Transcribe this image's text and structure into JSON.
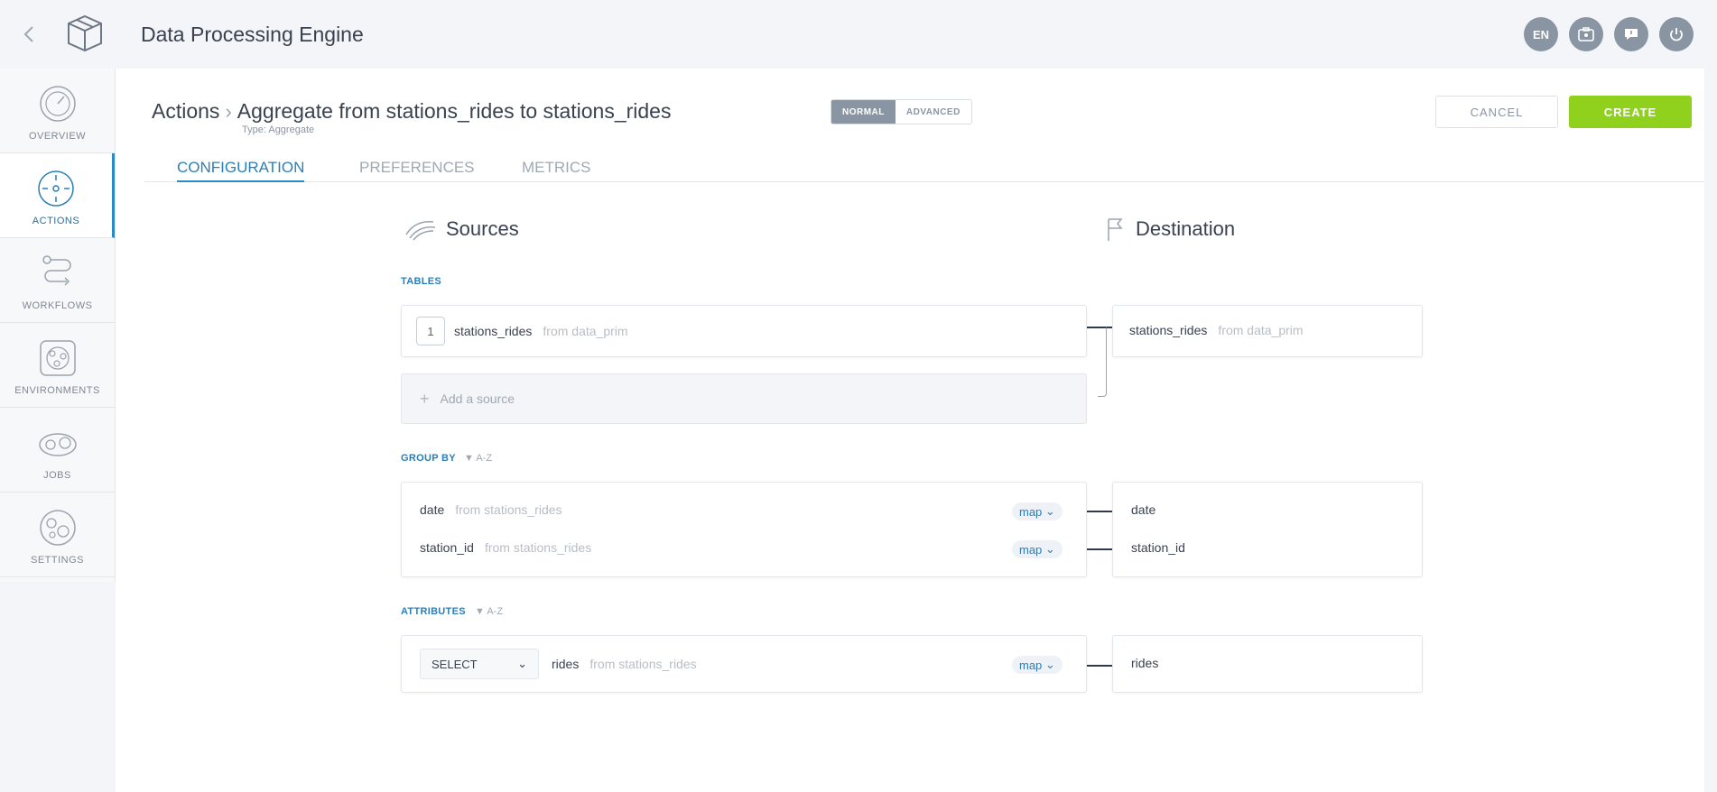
{
  "app": {
    "title": "Data Processing Engine"
  },
  "topbar": {
    "lang": "EN"
  },
  "sidebar": {
    "items": [
      {
        "label": "OVERVIEW"
      },
      {
        "label": "ACTIONS"
      },
      {
        "label": "WORKFLOWS"
      },
      {
        "label": "ENVIRONMENTS"
      },
      {
        "label": "JOBS"
      },
      {
        "label": "SETTINGS"
      }
    ]
  },
  "header": {
    "crumb_root": "Actions",
    "crumb_current": "Aggregate from stations_rides to stations_rides",
    "subtype": "Type: Aggregate",
    "mode_normal": "NORMAL",
    "mode_advanced": "ADVANCED",
    "cancel": "CANCEL",
    "create": "CREATE"
  },
  "tabs": [
    "CONFIGURATION",
    "PREFERENCES",
    "METRICS"
  ],
  "sources": {
    "title": "Sources",
    "destination_title": "Destination",
    "tables_label": "TABLES",
    "table_index": "1",
    "table_name": "stations_rides",
    "table_from": "from data_prim",
    "add_source": "Add a source",
    "dest_table_name": "stations_rides",
    "dest_table_from": "from data_prim"
  },
  "group_by": {
    "label": "GROUP BY",
    "sort": "A-Z",
    "rows": [
      {
        "name": "date",
        "from": "from stations_rides",
        "map": "map",
        "dest": "date"
      },
      {
        "name": "station_id",
        "from": "from stations_rides",
        "map": "map",
        "dest": "station_id"
      }
    ]
  },
  "attributes": {
    "label": "ATTRIBUTES",
    "sort": "A-Z",
    "select_value": "SELECT",
    "name": "rides",
    "from": "from stations_rides",
    "map": "map",
    "dest": "rides"
  },
  "colors": {
    "accent": "#2b8ac6",
    "create": "#8fd11c",
    "muted": "#8a95a3"
  }
}
